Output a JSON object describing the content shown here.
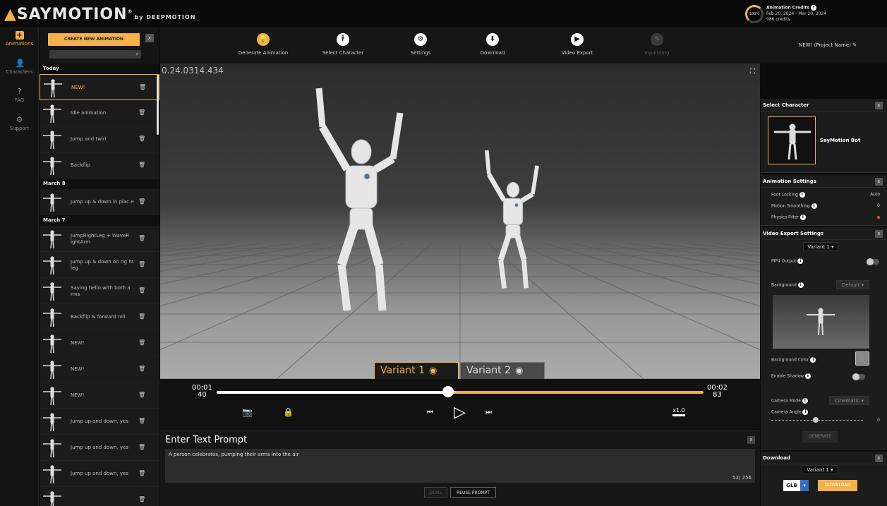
{
  "app": {
    "logo": "SAYMOTION",
    "logo_trademark": "®",
    "logo_sub": "by DEEPMOTION",
    "version": "0.24.0314.434"
  },
  "credits": {
    "percent": "100%",
    "title": "Animation Credits",
    "period": "Feb 20, 2024 - Mar 20, 2024",
    "amount": "986 credits"
  },
  "rail": [
    {
      "label": "Animations",
      "icon": "plus-icon",
      "glyph": "+",
      "active": true
    },
    {
      "label": "Characters",
      "icon": "person-icon",
      "glyph": "👤",
      "active": false
    },
    {
      "label": "FAQ",
      "icon": "question-icon",
      "glyph": "?",
      "active": false
    },
    {
      "label": "Support",
      "icon": "gear-icon",
      "glyph": "⚙",
      "active": false
    }
  ],
  "history": {
    "create_label": "CREATE NEW ANIMATION",
    "close_label": "x",
    "sections": [
      {
        "title": "Today",
        "items": [
          {
            "label": "NEW!",
            "active": true
          },
          {
            "label": "Idle animation"
          },
          {
            "label": "Jump and twirl"
          },
          {
            "label": "Backflip"
          }
        ]
      },
      {
        "title": "March 8",
        "items": [
          {
            "label": "Jump up & down in plac e"
          }
        ]
      },
      {
        "title": "March 7",
        "items": [
          {
            "label": "JumpRightLeg + WaveR ightArm"
          },
          {
            "label": "Jump up & down on rig ht leg"
          },
          {
            "label": "Saying hello with both a rms"
          },
          {
            "label": "Backflip & forward roll"
          },
          {
            "label": "NEW!"
          },
          {
            "label": "NEW!"
          },
          {
            "label": "NEW!"
          },
          {
            "label": "Jump up and down, yes"
          },
          {
            "label": "Jump up and down, yes"
          },
          {
            "label": "Jump up and down, yes"
          },
          {
            "label": ""
          }
        ]
      }
    ]
  },
  "toolbar": {
    "tools": [
      {
        "label": "Generate Animation",
        "icon": "lightbulb-icon",
        "glyph": "💡",
        "state": "active"
      },
      {
        "label": "Select Character",
        "icon": "character-icon",
        "glyph": "🕴",
        "state": "normal"
      },
      {
        "label": "Settings",
        "icon": "gear-icon",
        "glyph": "⚙",
        "state": "normal"
      },
      {
        "label": "Download",
        "icon": "download-icon",
        "glyph": "⬇",
        "state": "normal"
      },
      {
        "label": "Video Export",
        "icon": "play-circle-icon",
        "glyph": "▶",
        "state": "normal"
      },
      {
        "label": "Inpainting",
        "icon": "inpainting-icon",
        "glyph": "✎",
        "state": "disabled"
      }
    ],
    "project_name": "NEW! (Project Name)"
  },
  "viewport": {
    "variants": [
      {
        "label": "Variant 1",
        "active": true
      },
      {
        "label": "Variant 2",
        "active": false
      }
    ]
  },
  "timeline": {
    "current_time": "00:01",
    "current_frame": "40",
    "end_time": "00:02",
    "end_frame": "83",
    "progress": 0.475,
    "speed": "x1.0"
  },
  "prompt": {
    "title": "Enter Text Prompt",
    "close_label": "x",
    "text": "A person celebrates, pumping their arms into the air",
    "count": "52/ 256",
    "done_label": "DONE",
    "reuse_label": "REUSE PROMPT"
  },
  "select_character": {
    "title": "Select Character",
    "close_label": "x",
    "name": "SayMotion Bot"
  },
  "animation_settings": {
    "title": "Animation Settings",
    "close_label": "x",
    "rows": [
      {
        "label": "Foot Locking",
        "value": "Auto"
      },
      {
        "label": "Motion Smoothing",
        "value": "0"
      },
      {
        "label": "Physics Filter",
        "value": ""
      }
    ],
    "physics_dot_color": "#d9534f"
  },
  "video_export": {
    "title": "Video Export Settings",
    "close_label": "x",
    "variant": "Variant 1",
    "mp4_label": "MP4 Output",
    "background_label": "Background",
    "background_value": "Default",
    "bg_color_label": "Background Color",
    "shadow_label": "Enable Shadow",
    "camera_mode_label": "Camera Mode",
    "camera_mode_value": "Cinematic",
    "camera_angle_label": "Camera Angle",
    "camera_angle_value": "0",
    "generate_label": "GENERATE"
  },
  "download": {
    "title": "Download",
    "close_label": "x",
    "variant": "Variant 1",
    "format": "GLB",
    "download_label": "DOWNLOAD"
  },
  "colors": {
    "accent": "#f2b14a",
    "background": "#0b0b0b",
    "panel": "#1c1c1c"
  }
}
